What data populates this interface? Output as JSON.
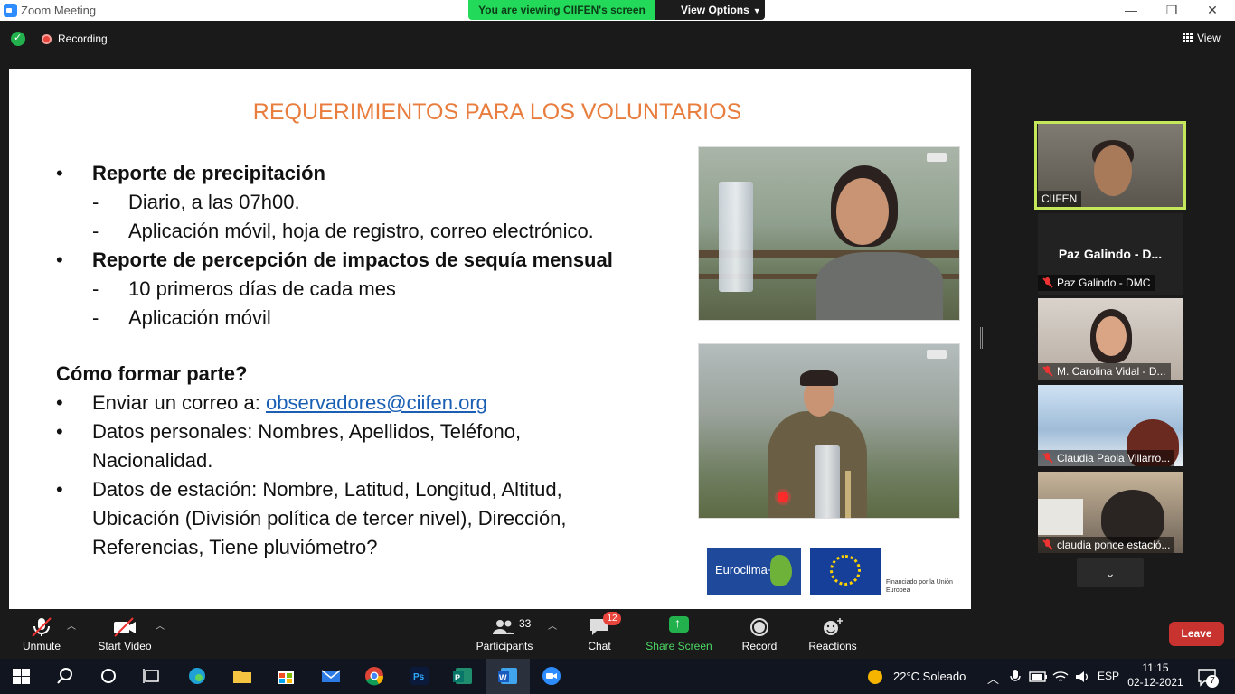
{
  "window": {
    "title": "Zoom Meeting"
  },
  "banner": {
    "viewing_text": "You are viewing CIIFEN's screen",
    "view_options": "View Options"
  },
  "status": {
    "recording": "Recording",
    "view": "View"
  },
  "slide": {
    "title": "REQUERIMIENTOS PARA LOS VOLUNTARIOS",
    "bullet1": "Reporte de precipitación",
    "bullet1_sub": [
      "Diario, a las 07h00.",
      "Aplicación móvil, hoja de registro, correo electrónico."
    ],
    "bullet2": "Reporte de percepción de impactos de sequía mensual",
    "bullet2_sub": [
      "10 primeros días de cada mes",
      "Aplicación móvil"
    ],
    "section": "Cómo formar parte?",
    "join_prefix": "Enviar un correo a: ",
    "join_email": "observadores@ciifen.org",
    "personal_data": "Datos personales: Nombres, Apellidos, Teléfono, Nacionalidad.",
    "station_data": "Datos de estación: Nombre, Latitud, Longitud, Altitud, Ubicación (División política de tercer nivel), Dirección, Referencias, Tiene pluviómetro?",
    "bullet_marker": "•",
    "sub_marker": "-",
    "logo1_text": "Euroclima+",
    "logo3_text": "Financiado por la Unión Europea"
  },
  "gallery": [
    {
      "name": "CIIFEN",
      "muted": false
    },
    {
      "big": "Paz Galindo - D...",
      "name": "Paz Galindo - DMC",
      "muted": true
    },
    {
      "name": "M. Carolina Vidal - D...",
      "muted": true
    },
    {
      "name": "Claudia Paola Villarro...",
      "muted": true
    },
    {
      "name": "claudia ponce estació...",
      "muted": true
    }
  ],
  "toolbar": {
    "unmute": "Unmute",
    "start_video": "Start Video",
    "participants_count": "33",
    "participants": "Participants",
    "chat": "Chat",
    "chat_badge": "12",
    "share_screen": "Share Screen",
    "record": "Record",
    "reactions": "Reactions",
    "leave": "Leave"
  },
  "taskbar": {
    "weather": "22°C  Soleado",
    "lang": "ESP",
    "time": "11:15",
    "date": "02-12-2021",
    "notifications": "7"
  },
  "colors": {
    "accent_green": "#23d959",
    "title_orange": "#e87d3e",
    "link_blue": "#1a5fb4",
    "leave_red": "#c8322f",
    "active_speaker": "#c5e85a"
  }
}
